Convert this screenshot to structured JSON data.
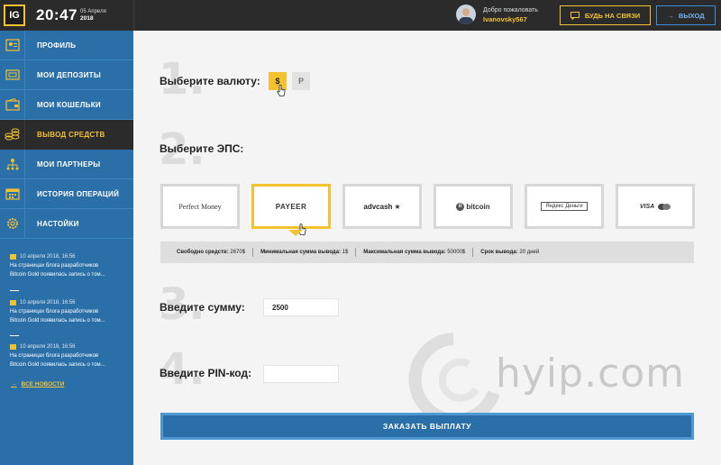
{
  "header": {
    "logo": "IG",
    "time": "20:47",
    "date_day": "05 Апреля",
    "date_year": "2018",
    "welcome": "Добро пожаловать",
    "username": "Ivanovsky567",
    "contact_label": "БУДЬ НА СВЯЗИ",
    "exit_label": "ВЫХОД"
  },
  "sidebar": {
    "items": [
      {
        "label": "ПРОФИЛЬ",
        "icon": "profile-icon"
      },
      {
        "label": "МОИ ДЕПОЗИТЫ",
        "icon": "deposits-icon"
      },
      {
        "label": "МОИ КОШЕЛЬКИ",
        "icon": "wallet-icon"
      },
      {
        "label": "ВЫВОД СРЕДСТВ",
        "icon": "withdraw-icon",
        "active": true
      },
      {
        "label": "МОИ ПАРТНЕРЫ",
        "icon": "partners-icon"
      },
      {
        "label": "ИСТОРИЯ ОПЕРАЦИЙ",
        "icon": "history-icon"
      },
      {
        "label": "НАСТОЙКИ",
        "icon": "settings-icon"
      }
    ],
    "news": [
      {
        "date": "10 апреля 2018, 16:56",
        "line1": "На страницах блога разработчиков",
        "line2": "Bitcoin Gold появилась запись о том..."
      },
      {
        "date": "10 апреля 2018, 16:56",
        "line1": "На страницах блога разработчиков",
        "line2": "Bitcoin Gold появилась запись о том..."
      },
      {
        "date": "10 апреля 2018, 16:56",
        "line1": "На страницах блога разработчиков",
        "line2": "Bitcoin Gold появилась запись о том..."
      }
    ],
    "all_news": "ВСЕ НОВОСТИ"
  },
  "main": {
    "step1": {
      "num": "1.",
      "label": "Выберите валюту:",
      "usd": "$",
      "rub": "Р"
    },
    "step2": {
      "num": "2.",
      "label": "Выберите ЭПС:"
    },
    "eps": [
      "Perfect Money",
      "PAYEER",
      "advcash",
      "bitcoin",
      "Яндекс Деньги",
      "VISA"
    ],
    "info": {
      "free_label": "Свободно средств:",
      "free_value": "2670$",
      "min_label": "Минимальная сумма вывода:",
      "min_value": "1$",
      "max_label": "Максимальная сумма вывода:",
      "max_value": "50000$",
      "term_label": "Срок вывода:",
      "term_value": "20 дней"
    },
    "step3": {
      "num": "3.",
      "label": "Введите сумму:",
      "value": "2500"
    },
    "step4": {
      "num": "4.",
      "label": "Введите PIN-код:",
      "value": ""
    },
    "watermark": "hyip.com",
    "submit_label": "ЗАКАЗАТЬ ВЫПЛАТУ"
  },
  "colors": {
    "accent": "#f2c230",
    "sidebar": "#2a6fa8",
    "header": "#2b2b2b"
  }
}
